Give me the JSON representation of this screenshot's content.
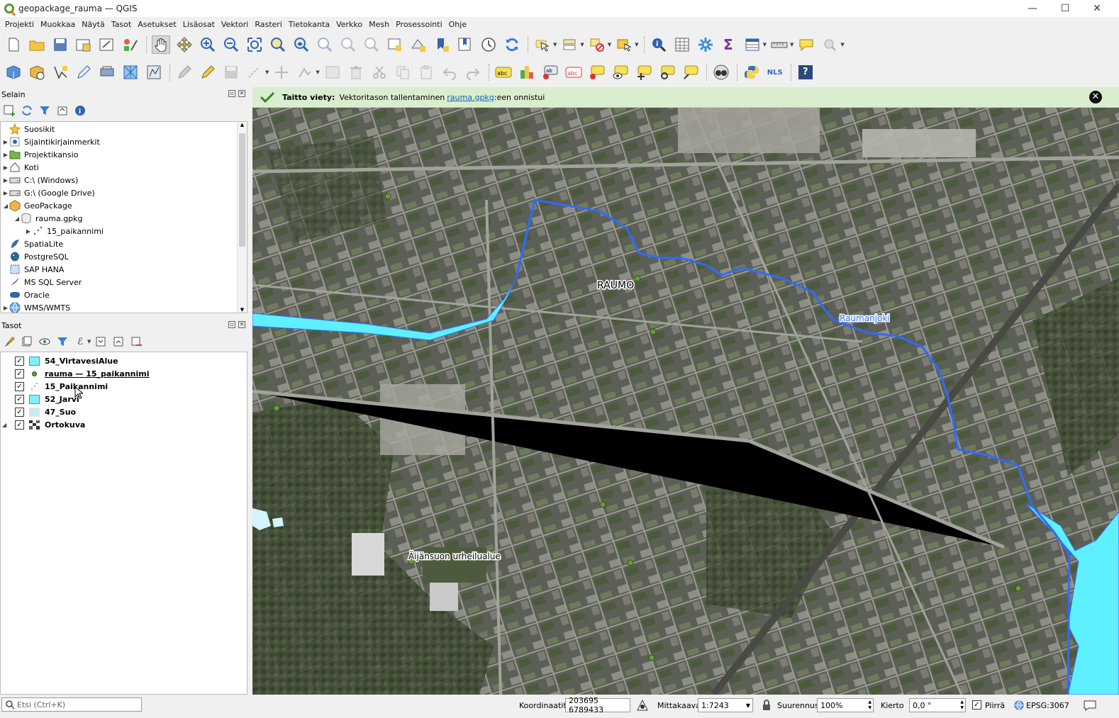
{
  "window": {
    "title": "geopackage_rauma — QGIS",
    "minimize": "—",
    "maximize": "☐",
    "close": "✕"
  },
  "menu": [
    "Projekti",
    "Muokkaa",
    "Näytä",
    "Tasot",
    "Asetukset",
    "Lisäosat",
    "Vektori",
    "Rasteri",
    "Tietokanta",
    "Verkko",
    "Mesh",
    "Prosessointi",
    "Ohje"
  ],
  "toolbar2": {
    "nls_label": "NLS",
    "help_label": "?"
  },
  "browser": {
    "title": "Selain",
    "items": [
      {
        "label": "Suosikit",
        "icon": "star-icon"
      },
      {
        "label": "Sijaintikirjainmerkit",
        "icon": "bookmark-icon"
      },
      {
        "label": "Projektikansio",
        "icon": "project-folder-icon"
      },
      {
        "label": "Koti",
        "icon": "home-icon"
      },
      {
        "label": "C:\\ (Windows)",
        "icon": "drive-icon"
      },
      {
        "label": "G:\\ (Google Drive)",
        "icon": "drive-icon"
      },
      {
        "label": "GeoPackage",
        "icon": "geopackage-icon"
      },
      {
        "label": "rauma.gpkg",
        "icon": "database-icon"
      },
      {
        "label": "15_paikannimi",
        "icon": "point-layer-icon"
      },
      {
        "label": "SpatiaLite",
        "icon": "spatialite-icon"
      },
      {
        "label": "PostgreSQL",
        "icon": "postgresql-icon"
      },
      {
        "label": "SAP HANA",
        "icon": "saphana-icon"
      },
      {
        "label": "MS SQL Server",
        "icon": "mssql-icon"
      },
      {
        "label": "Oracle",
        "icon": "oracle-icon"
      },
      {
        "label": "WMS/WMTS",
        "icon": "globe-icon"
      }
    ]
  },
  "layers": {
    "title": "Tasot",
    "items": [
      {
        "label": "54_VirtavesiAlue",
        "checked": "✓",
        "color": "#7ff0ff"
      },
      {
        "label": "rauma — 15_paikannimi",
        "checked": "✓",
        "color": "#6a9a3a"
      },
      {
        "label": "15_Paikannimi",
        "checked": "✓",
        "color": "#999999"
      },
      {
        "label": "52_Jarvi",
        "checked": "✓",
        "color": "#7ff0ff"
      },
      {
        "label": "47_Suo",
        "checked": "✓",
        "color": "#cfe9f0"
      },
      {
        "label": "Ortokuva",
        "checked": "✓",
        "color": "#333333"
      }
    ]
  },
  "message": {
    "title": "Taitto viety:",
    "text_before": "Vektoritason tallentaminen",
    "link": "rauma.gpkg",
    "text_after": ":een onnistui",
    "close": "✕"
  },
  "map": {
    "labels": {
      "town": "RAUMO",
      "river": "Raumanjoki",
      "sports": "Äijänsuon urheilualue"
    },
    "colors": {
      "water": "#5ef0ff",
      "river_line": "#2f6bff",
      "ortho_base": "#5c5f55"
    }
  },
  "status": {
    "search_placeholder": "Etsi (Ctrl+K)",
    "coord_label": "Koordinaatit",
    "coord_value": "203695  6789433",
    "scale_label": "Mittakaava",
    "scale_value": "1:7243",
    "magnifier_label": "Suurennus",
    "magnifier_value": "100%",
    "rotation_label": "Kierto",
    "rotation_value": "0,0 °",
    "render_label": "Piirrä",
    "render_checked": "✓",
    "crs": "EPSG:3067"
  }
}
